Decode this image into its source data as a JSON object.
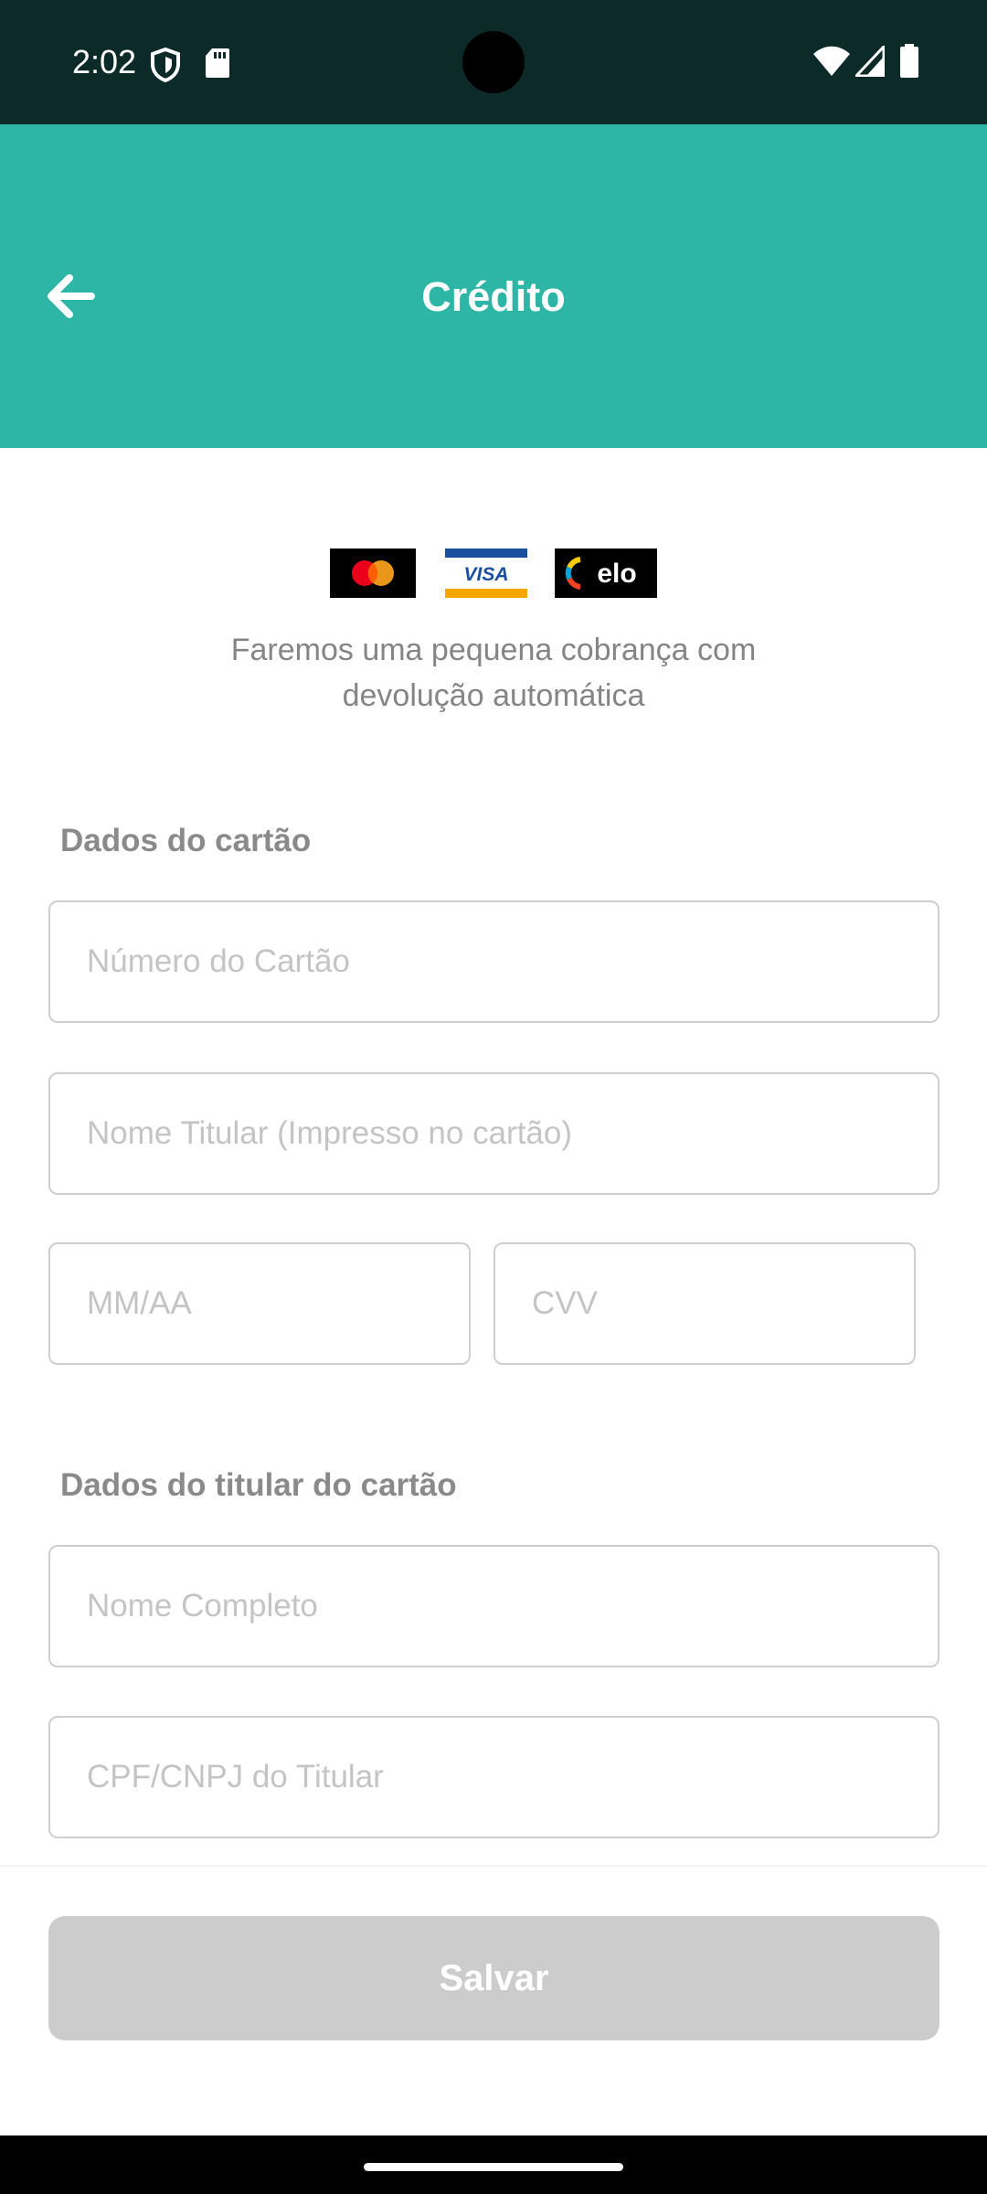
{
  "status_bar": {
    "time": "2:02",
    "icons": [
      "shield-icon",
      "sd-card-icon",
      "wifi-icon",
      "signal-icon",
      "battery-icon"
    ]
  },
  "app_bar": {
    "title": "Crédito",
    "back_icon": "arrow-left-icon",
    "color": "#2db6a6"
  },
  "brands": [
    "mastercard",
    "visa",
    "elo"
  ],
  "info": {
    "line1": "Faremos uma pequena cobrança com",
    "line2": "devolução automática"
  },
  "card_section": {
    "label": "Dados do cartão",
    "card_number": {
      "placeholder": "Número do Cartão",
      "value": ""
    },
    "holder_name": {
      "placeholder": "Nome Titular (Impresso no cartão)",
      "value": ""
    },
    "expiry": {
      "placeholder": "MM/AA",
      "value": ""
    },
    "cvv": {
      "placeholder": "CVV",
      "value": ""
    }
  },
  "holder_section": {
    "label": "Dados do titular do cartão",
    "full_name": {
      "placeholder": "Nome Completo",
      "value": ""
    },
    "document": {
      "placeholder": "CPF/CNPJ do Titular",
      "value": ""
    }
  },
  "save_button": {
    "label": "Salvar",
    "color": "#cccccc"
  }
}
